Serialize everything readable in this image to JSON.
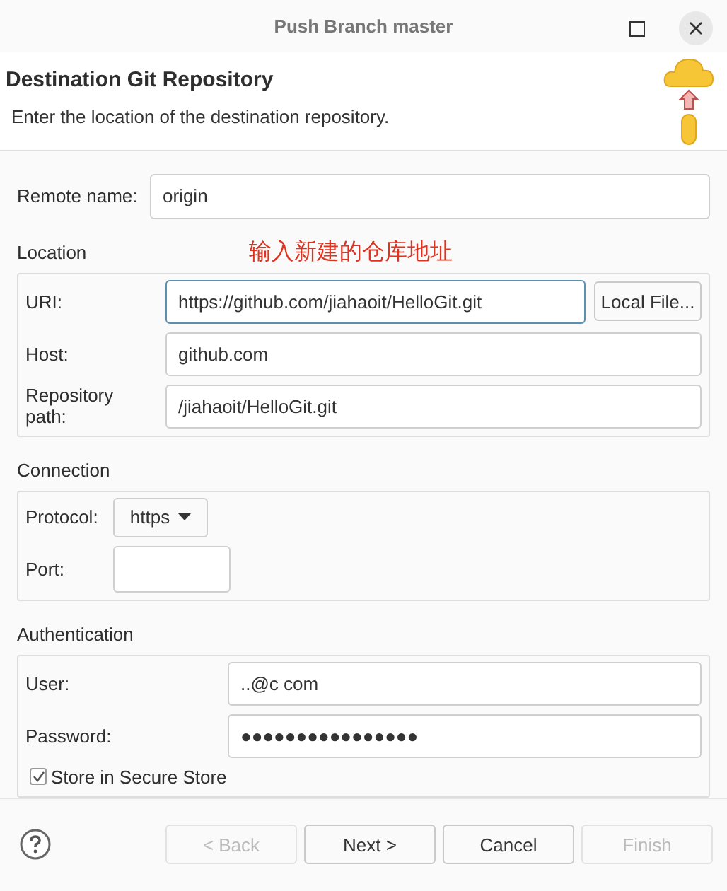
{
  "window": {
    "title": "Push Branch master"
  },
  "header": {
    "title": "Destination Git Repository",
    "description": "Enter the location of the destination repository."
  },
  "remote_name": {
    "label": "Remote name:",
    "value": "origin"
  },
  "annotation": "输入新建的仓库地址",
  "location": {
    "title": "Location",
    "uri": {
      "label": "URI:",
      "value": "https://github.com/jiahaoit/HelloGit.git",
      "focused": true
    },
    "local_file_button": "Local File...",
    "host": {
      "label": "Host:",
      "value": "github.com"
    },
    "repository_path": {
      "label": "Repository path:",
      "value": "/jiahaoit/HelloGit.git"
    }
  },
  "connection": {
    "title": "Connection",
    "protocol": {
      "label": "Protocol:",
      "value": "https"
    },
    "port": {
      "label": "Port:"
    }
  },
  "authentication": {
    "title": "Authentication",
    "user": {
      "label": "User:",
      "value": "..@c com"
    },
    "password": {
      "label": "Password:",
      "value": "●●●●●●●●●●●●●●●●"
    },
    "store": {
      "label": "Store in Secure Store",
      "checked": true
    }
  },
  "buttons": [
    {
      "label": "< Back",
      "disabled": true
    },
    {
      "label": "Next >",
      "disabled": false
    },
    {
      "label": "Cancel",
      "disabled": false
    },
    {
      "label": "Finish",
      "disabled": true
    }
  ]
}
